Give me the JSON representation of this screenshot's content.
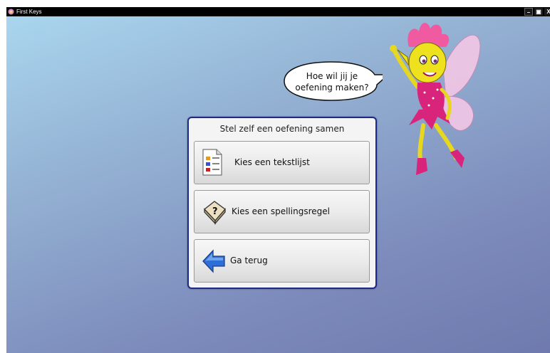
{
  "window": {
    "title": "First Keys",
    "controls": {
      "minimize": "–",
      "maximize": "▣",
      "close": "X"
    }
  },
  "character": {
    "speech": [
      "Hoe wil jij je",
      "oefening maken?"
    ]
  },
  "panel": {
    "title": "Stel zelf een oefening samen",
    "buttons": [
      {
        "label": "Kies een tekstlijst",
        "icon": "list-document-icon"
      },
      {
        "label": "Kies een spellingsregel",
        "icon": "question-key-icon"
      },
      {
        "label": "Ga terug",
        "icon": "back-arrow-icon"
      }
    ]
  },
  "colors": {
    "panel_border": "#1e2a8a",
    "background_top": "#a9d6ef",
    "background_bottom": "#6f79ad"
  }
}
